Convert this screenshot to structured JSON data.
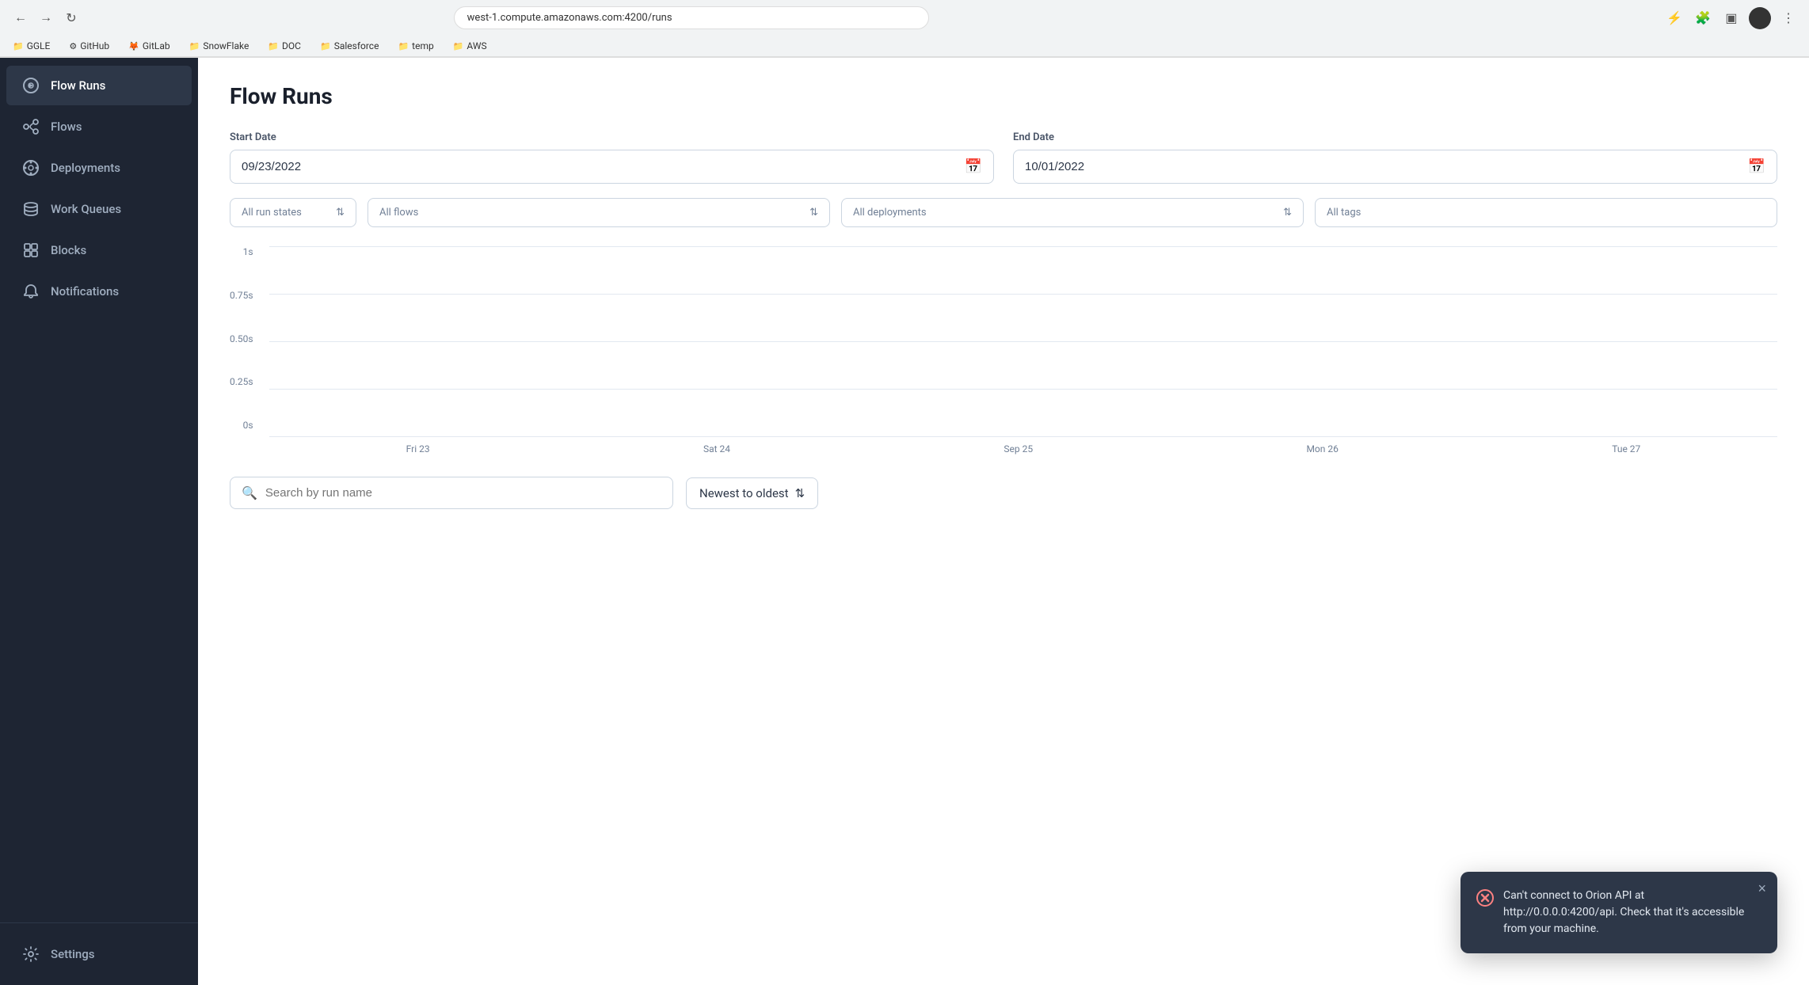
{
  "browser": {
    "address": "west-1.compute.amazonaws.com:4200/runs",
    "bookmarks": [
      {
        "label": "GGLE",
        "icon": "📁"
      },
      {
        "label": "GitHub",
        "icon": "📁"
      },
      {
        "label": "GitLab",
        "icon": "📁"
      },
      {
        "label": "SnowFlake",
        "icon": "📁"
      },
      {
        "label": "DOC",
        "icon": "📁"
      },
      {
        "label": "Salesforce",
        "icon": "📁"
      },
      {
        "label": "temp",
        "icon": "📁"
      },
      {
        "label": "AWS",
        "icon": "📁"
      }
    ]
  },
  "sidebar": {
    "items": [
      {
        "label": "Flow Runs",
        "icon": "flow-runs-icon",
        "active": true
      },
      {
        "label": "Flows",
        "icon": "flows-icon",
        "active": false
      },
      {
        "label": "Deployments",
        "icon": "deployments-icon",
        "active": false
      },
      {
        "label": "Work Queues",
        "icon": "work-queues-icon",
        "active": false
      },
      {
        "label": "Blocks",
        "icon": "blocks-icon",
        "active": false
      },
      {
        "label": "Notifications",
        "icon": "notifications-icon",
        "active": false
      }
    ],
    "settings_label": "Settings"
  },
  "page": {
    "title": "Flow Runs"
  },
  "filters": {
    "start_date_label": "Start Date",
    "start_date_value": "09/23/2022",
    "end_date_label": "End Date",
    "end_date_value": "10/01/2022",
    "run_states_label": "All run states",
    "flows_label": "All flows",
    "deployments_label": "All deployments",
    "tags_label": "All tags"
  },
  "chart": {
    "y_labels": [
      "1s",
      "0.75s",
      "0.50s",
      "0.25s",
      "0s"
    ],
    "x_labels": [
      "Fri 23",
      "Sat 24",
      "Sep 25",
      "Mon 26",
      "Tue 27"
    ]
  },
  "search": {
    "placeholder": "Search by run name",
    "sort_label": "Newest to oldest"
  },
  "toast": {
    "message": "Can't connect to Orion API at http://0.0.0.0:4200/api. Check that it's accessible from your machine.",
    "close_label": "×"
  }
}
